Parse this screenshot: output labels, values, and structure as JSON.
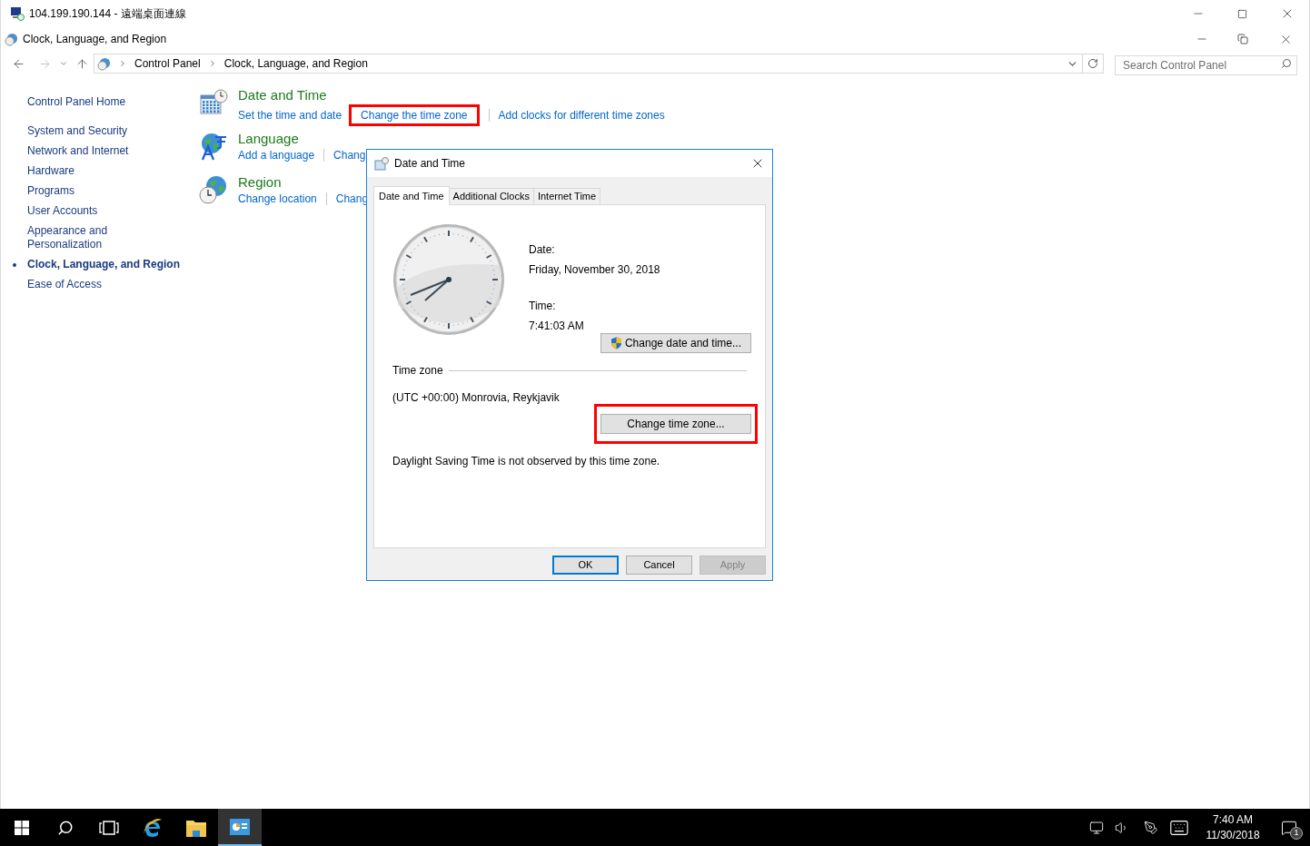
{
  "rdp_window": {
    "title": "104.199.190.144 - 遠端桌面連線"
  },
  "window": {
    "title": "Clock, Language, and Region"
  },
  "address_bar": {
    "breadcrumbs": [
      "Control Panel",
      "Clock, Language, and Region"
    ]
  },
  "search": {
    "placeholder": "Search Control Panel"
  },
  "sidebar": {
    "items": [
      {
        "label": "Control Panel Home",
        "selected": false
      },
      {
        "label": "System and Security",
        "selected": false
      },
      {
        "label": "Network and Internet",
        "selected": false
      },
      {
        "label": "Hardware",
        "selected": false
      },
      {
        "label": "Programs",
        "selected": false
      },
      {
        "label": "User Accounts",
        "selected": false
      },
      {
        "label": "Appearance and Personalization",
        "selected": false
      },
      {
        "label": "Clock, Language, and Region",
        "selected": true
      },
      {
        "label": "Ease of Access",
        "selected": false
      }
    ]
  },
  "categories": [
    {
      "kind": "datetime",
      "title": "Date and Time",
      "links": [
        {
          "label": "Set the time and date",
          "highlighted": false
        },
        {
          "label": "Change the time zone",
          "highlighted": true
        },
        {
          "label": "Add clocks for different time zones",
          "highlighted": false
        }
      ]
    },
    {
      "kind": "language",
      "title": "Language",
      "links": [
        {
          "label": "Add a language",
          "highlighted": false
        },
        {
          "label": "Chang",
          "highlighted": false
        }
      ]
    },
    {
      "kind": "region",
      "title": "Region",
      "links": [
        {
          "label": "Change location",
          "highlighted": false
        },
        {
          "label": "Chang",
          "highlighted": false
        }
      ]
    }
  ],
  "dialog": {
    "title": "Date and Time",
    "tabs": [
      {
        "label": "Date and Time",
        "selected": true
      },
      {
        "label": "Additional Clocks",
        "selected": false
      },
      {
        "label": "Internet Time",
        "selected": false
      }
    ],
    "date_label": "Date:",
    "date": "Friday, November 30, 2018",
    "time_label": "Time:",
    "time": "7:41:03 AM",
    "change_datetime_button": {
      "label": "Change date and time...",
      "highlighted": false
    },
    "time_zone_heading": "Time zone",
    "time_zone": "(UTC +00:00) Monrovia, Reykjavik",
    "change_zone_button": {
      "label": "Change time zone...",
      "highlighted": true
    },
    "dst_note": "Daylight Saving Time is not observed by this time zone.",
    "buttons": [
      {
        "label": "OK",
        "default": true,
        "disabled": false
      },
      {
        "label": "Cancel",
        "default": false,
        "disabled": false
      },
      {
        "label": "Apply",
        "default": false,
        "disabled": true
      }
    ]
  },
  "taskbar": {
    "apps": [
      {
        "kind": "browser",
        "selected": false
      },
      {
        "kind": "folder",
        "selected": false
      },
      {
        "kind": "control-panel",
        "selected": true
      }
    ],
    "clock": {
      "time": "7:40 AM",
      "date": "11/30/2018"
    },
    "notification_count": "1"
  }
}
